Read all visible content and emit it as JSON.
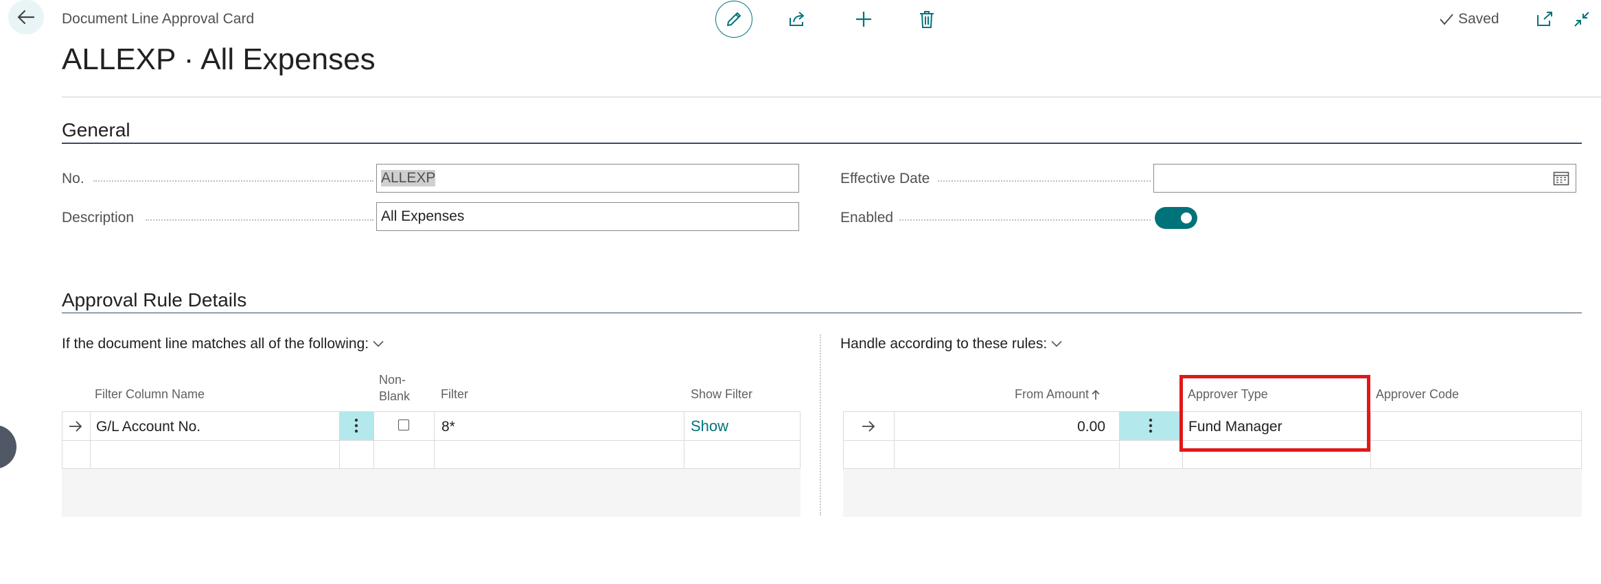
{
  "header": {
    "breadcrumb": "Document Line Approval Card",
    "title": "ALLEXP · All Expenses",
    "saved_label": "Saved"
  },
  "general": {
    "section_title": "General",
    "no_label": "No.",
    "no_value": "ALLEXP",
    "description_label": "Description",
    "description_value": "All Expenses",
    "effective_date_label": "Effective Date",
    "effective_date_value": "",
    "enabled_label": "Enabled",
    "enabled": true
  },
  "details": {
    "section_title": "Approval Rule Details",
    "left_caption": "If the document line matches all of the following:",
    "right_caption": "Handle according to these rules:",
    "left_table": {
      "headers": {
        "filter_column_name": "Filter Column Name",
        "non_blank_line1": "Non-",
        "non_blank_line2": "Blank",
        "filter": "Filter",
        "show_filter": "Show Filter"
      },
      "rows": [
        {
          "filter_column_name": "G/L Account No.",
          "non_blank": false,
          "filter": "8*",
          "show_filter": "Show"
        }
      ]
    },
    "right_table": {
      "headers": {
        "from_amount": "From Amount",
        "approver_type": "Approver Type",
        "approver_code": "Approver Code"
      },
      "rows": [
        {
          "from_amount": "0.00",
          "approver_type": "Fund Manager",
          "approver_code": ""
        }
      ]
    }
  },
  "colors": {
    "accent": "#00737a",
    "selected_cell": "#b3e8ec",
    "highlight_box": "#e01818"
  }
}
